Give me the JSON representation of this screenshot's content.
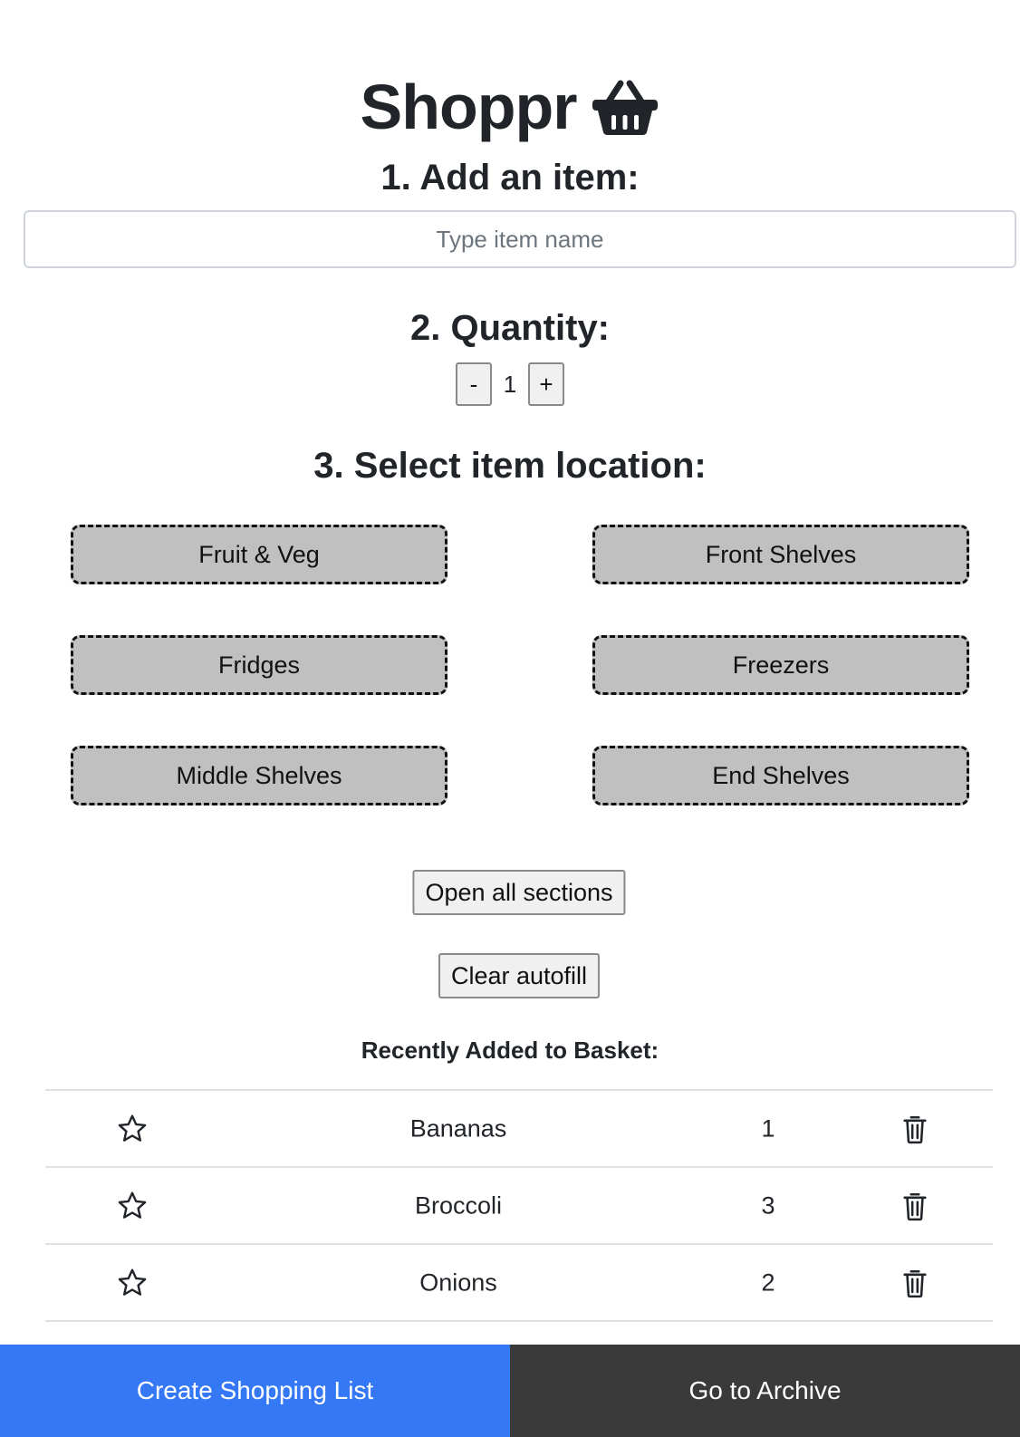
{
  "header": {
    "title": "Shoppr",
    "icon": "basket-icon"
  },
  "steps": {
    "add_item": "1. Add an item:",
    "quantity": "2. Quantity:",
    "location": "3. Select item location:"
  },
  "item_input": {
    "placeholder": "Type item name",
    "value": ""
  },
  "quantity": {
    "decrement_label": "-",
    "value": "1",
    "increment_label": "+"
  },
  "locations": [
    "Fruit & Veg",
    "Front Shelves",
    "Fridges",
    "Freezers",
    "Middle Shelves",
    "End Shelves"
  ],
  "actions": {
    "open_all": "Open all sections",
    "clear_autofill": "Clear autofill"
  },
  "recent": {
    "title": "Recently Added to Basket:",
    "items": [
      {
        "name": "Bananas",
        "qty": "1",
        "favorite_icon": "star-icon",
        "delete_icon": "trash-icon"
      },
      {
        "name": "Broccoli",
        "qty": "3",
        "favorite_icon": "star-icon",
        "delete_icon": "trash-icon"
      },
      {
        "name": "Onions",
        "qty": "2",
        "favorite_icon": "star-icon",
        "delete_icon": "trash-icon"
      }
    ]
  },
  "footer": {
    "create_list": "Create Shopping List",
    "archive": "Go to Archive"
  },
  "colors": {
    "primary": "#3478f6",
    "dark": "#3a3a3a",
    "location_bg": "#c0c0c0"
  }
}
